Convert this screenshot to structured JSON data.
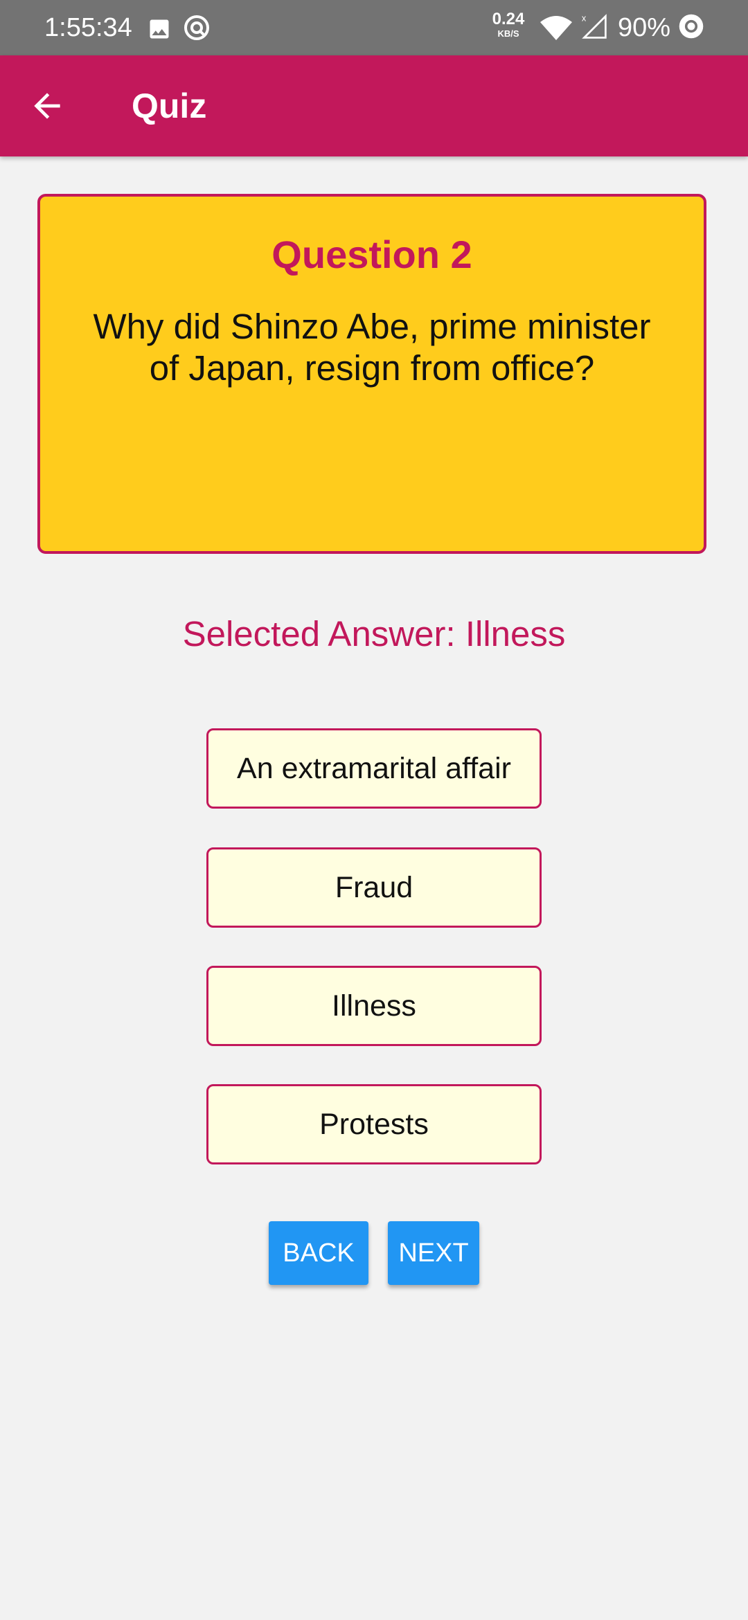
{
  "status_bar": {
    "time": "1:55:34",
    "network_speed": "0.24",
    "network_unit": "KB/S",
    "battery": "90%",
    "icons": [
      "image-icon",
      "sync-icon",
      "wifi-icon",
      "signal-icon",
      "battery-icon"
    ]
  },
  "app_bar": {
    "title": "Quiz",
    "background_color": "#c2185b"
  },
  "question": {
    "number_label": "Question 2",
    "text": "Why did Shinzo Abe, prime minister of Japan, resign from office?",
    "card_color": "#ffcc1c"
  },
  "selected_answer": "Selected Answer: Illness",
  "options": [
    "An extramarital affair",
    "Fraud",
    "Illness",
    "Protests"
  ],
  "buttons": {
    "back": "BACK",
    "next": "NEXT",
    "color": "#2196f3"
  }
}
